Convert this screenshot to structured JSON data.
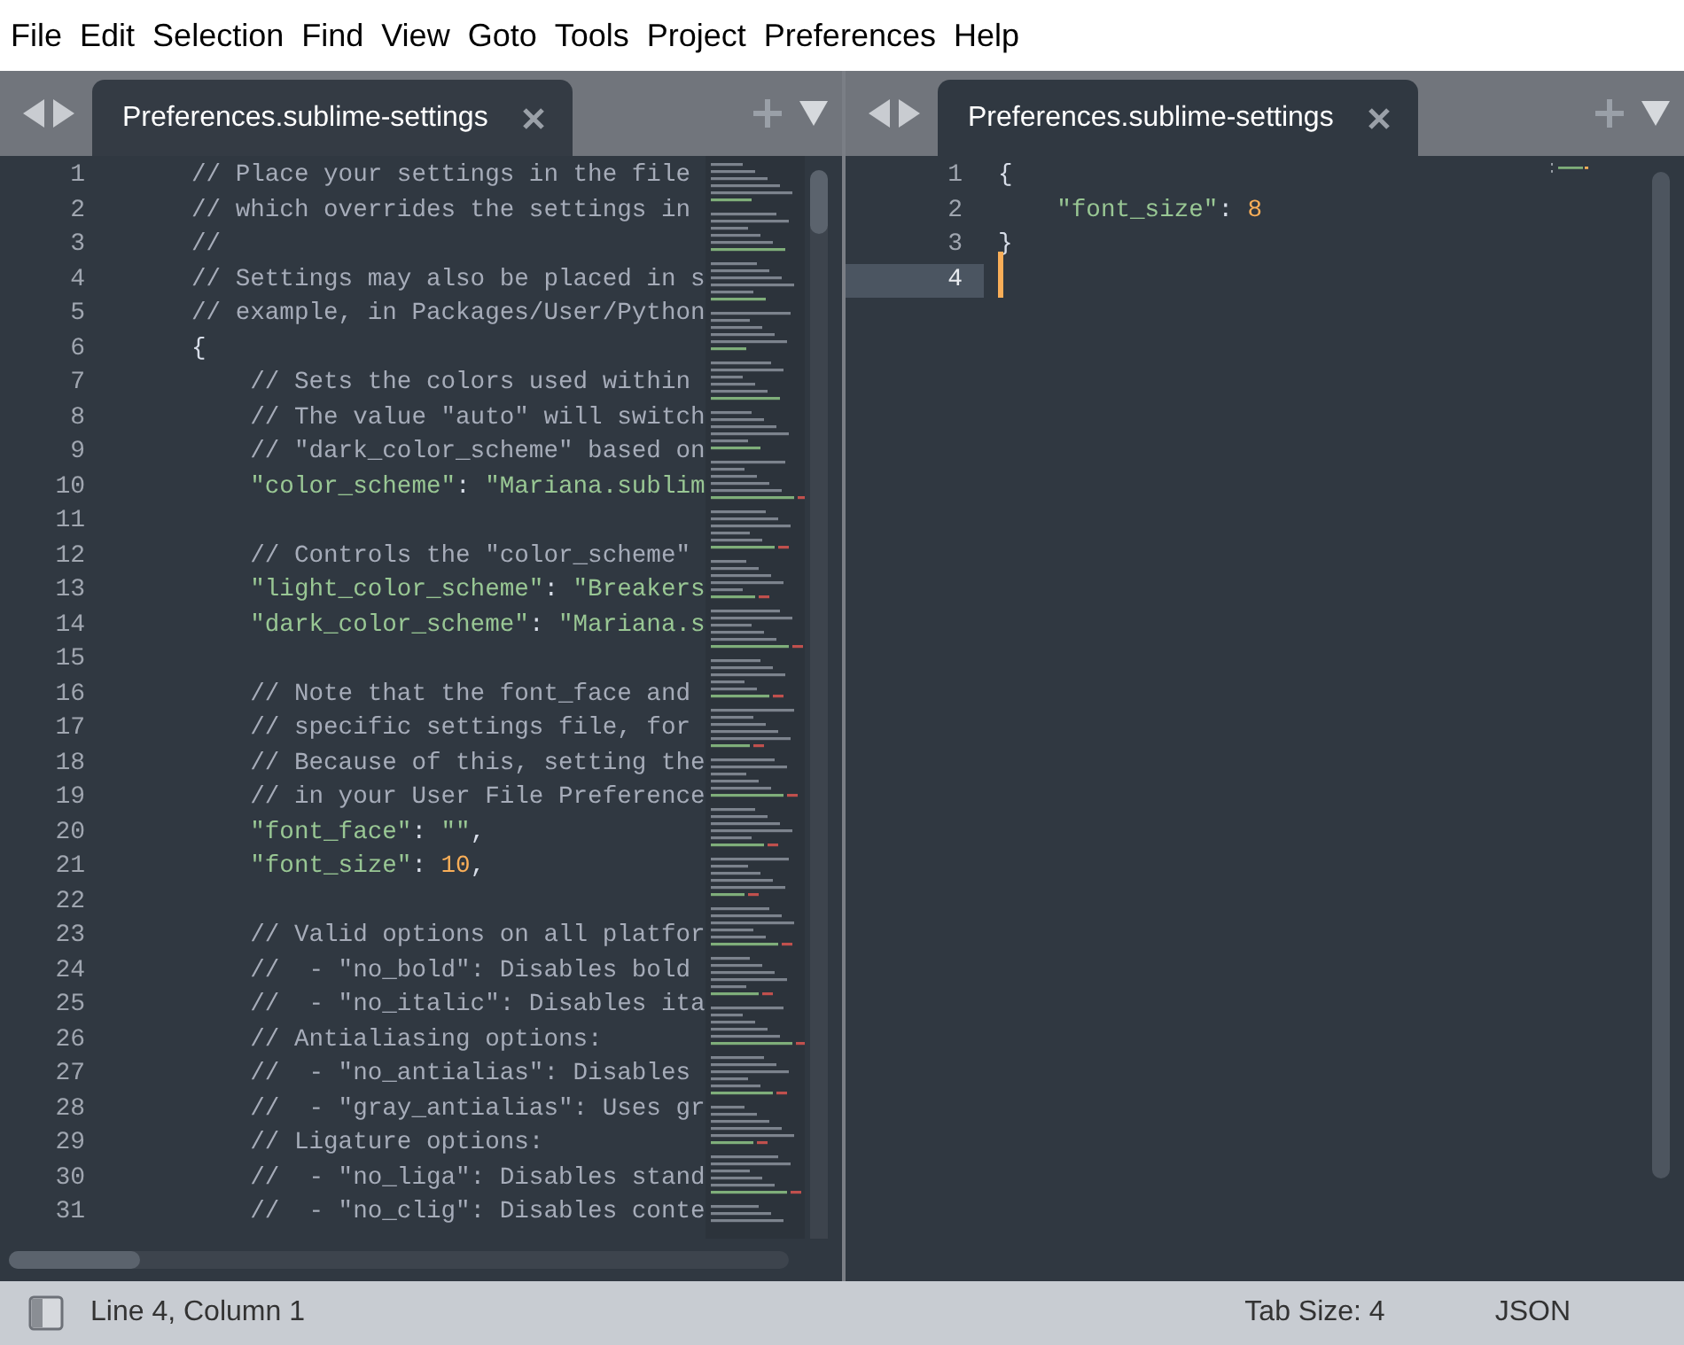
{
  "menu": [
    "File",
    "Edit",
    "Selection",
    "Find",
    "View",
    "Goto",
    "Tools",
    "Project",
    "Preferences",
    "Help"
  ],
  "panes": [
    {
      "tab": {
        "title": "Preferences.sublime-settings",
        "selected": true
      },
      "lines": [
        {
          "n": "1",
          "current": false,
          "tokens": [
            {
              "kind": "comment",
              "text": "// Place your settings in the file"
            }
          ]
        },
        {
          "n": "2",
          "current": false,
          "tokens": [
            {
              "kind": "comment",
              "text": "// which overrides the settings in"
            }
          ]
        },
        {
          "n": "3",
          "current": false,
          "tokens": [
            {
              "kind": "comment",
              "text": "//"
            }
          ]
        },
        {
          "n": "4",
          "current": false,
          "tokens": [
            {
              "kind": "comment",
              "text": "// Settings may also be placed in s"
            }
          ]
        },
        {
          "n": "5",
          "current": false,
          "tokens": [
            {
              "kind": "comment",
              "text": "// example, in Packages/User/Python"
            }
          ]
        },
        {
          "n": "6",
          "current": false,
          "tokens": [
            {
              "kind": "punct",
              "text": "{"
            }
          ]
        },
        {
          "n": "7",
          "current": false,
          "tokens": [
            {
              "kind": "comment",
              "text": "    // Sets the colors used within"
            }
          ]
        },
        {
          "n": "8",
          "current": false,
          "tokens": [
            {
              "kind": "comment",
              "text": "    // The value \"auto\" will switch"
            }
          ]
        },
        {
          "n": "9",
          "current": false,
          "tokens": [
            {
              "kind": "comment",
              "text": "    // \"dark_color_scheme\" based on"
            }
          ]
        },
        {
          "n": "10",
          "current": false,
          "tokens": [
            {
              "kind": "string",
              "text": "    \"color_scheme\""
            },
            {
              "kind": "punct",
              "text": ": "
            },
            {
              "kind": "string",
              "text": "\"Mariana.sublim"
            }
          ]
        },
        {
          "n": "11",
          "current": false
        },
        {
          "n": "12",
          "current": false,
          "tokens": [
            {
              "kind": "comment",
              "text": "    // Controls the \"color_scheme\""
            }
          ]
        },
        {
          "n": "13",
          "current": false,
          "tokens": [
            {
              "kind": "string",
              "text": "    \"light_color_scheme\""
            },
            {
              "kind": "punct",
              "text": ": "
            },
            {
              "kind": "string",
              "text": "\"Breakers"
            }
          ]
        },
        {
          "n": "14",
          "current": false,
          "tokens": [
            {
              "kind": "string",
              "text": "    \"dark_color_scheme\""
            },
            {
              "kind": "punct",
              "text": ": "
            },
            {
              "kind": "string",
              "text": "\"Mariana.s"
            }
          ]
        },
        {
          "n": "15",
          "current": false
        },
        {
          "n": "16",
          "current": false,
          "tokens": [
            {
              "kind": "comment",
              "text": "    // Note that the font_face and"
            }
          ]
        },
        {
          "n": "17",
          "current": false,
          "tokens": [
            {
              "kind": "comment",
              "text": "    // specific settings file, for"
            }
          ]
        },
        {
          "n": "18",
          "current": false,
          "tokens": [
            {
              "kind": "comment",
              "text": "    // Because of this, setting the"
            }
          ]
        },
        {
          "n": "19",
          "current": false,
          "tokens": [
            {
              "kind": "comment",
              "text": "    // in your User File Preference"
            }
          ]
        },
        {
          "n": "20",
          "current": false,
          "tokens": [
            {
              "kind": "string",
              "text": "    \"font_face\""
            },
            {
              "kind": "punct",
              "text": ": "
            },
            {
              "kind": "string",
              "text": "\"\""
            },
            {
              "kind": "punct",
              "text": ","
            }
          ]
        },
        {
          "n": "21",
          "current": false,
          "tokens": [
            {
              "kind": "string",
              "text": "    \"font_size\""
            },
            {
              "kind": "punct",
              "text": ": "
            },
            {
              "kind": "number",
              "text": "10"
            },
            {
              "kind": "punct",
              "text": ","
            }
          ]
        },
        {
          "n": "22",
          "current": false
        },
        {
          "n": "23",
          "current": false,
          "tokens": [
            {
              "kind": "comment",
              "text": "    // Valid options on all platfor"
            }
          ]
        },
        {
          "n": "24",
          "current": false,
          "tokens": [
            {
              "kind": "comment",
              "text": "    //  - \"no_bold\": Disables bold"
            }
          ]
        },
        {
          "n": "25",
          "current": false,
          "tokens": [
            {
              "kind": "comment",
              "text": "    //  - \"no_italic\": Disables ita"
            }
          ]
        },
        {
          "n": "26",
          "current": false,
          "tokens": [
            {
              "kind": "comment",
              "text": "    // Antialiasing options:"
            }
          ]
        },
        {
          "n": "27",
          "current": false,
          "tokens": [
            {
              "kind": "comment",
              "text": "    //  - \"no_antialias\": Disables"
            }
          ]
        },
        {
          "n": "28",
          "current": false,
          "tokens": [
            {
              "kind": "comment",
              "text": "    //  - \"gray_antialias\": Uses gr"
            }
          ]
        },
        {
          "n": "29",
          "current": false,
          "tokens": [
            {
              "kind": "comment",
              "text": "    // Ligature options:"
            }
          ]
        },
        {
          "n": "30",
          "current": false,
          "tokens": [
            {
              "kind": "comment",
              "text": "    //  - \"no_liga\": Disables stand"
            }
          ]
        },
        {
          "n": "31",
          "current": false,
          "tokens": [
            {
              "kind": "comment",
              "text": "    //  - \"no_clig\": Disables conte"
            }
          ]
        }
      ]
    },
    {
      "tab": {
        "title": "Preferences.sublime-settings",
        "selected": true
      },
      "lines": [
        {
          "n": "1",
          "current": false,
          "tokens": [
            {
              "kind": "punct",
              "text": "{"
            }
          ]
        },
        {
          "n": "2",
          "current": false,
          "tokens": [
            {
              "kind": "string",
              "text": "    \"font_size\""
            },
            {
              "kind": "punct",
              "text": ": "
            },
            {
              "kind": "number",
              "text": "8"
            }
          ]
        },
        {
          "n": "3",
          "current": false,
          "tokens": [
            {
              "kind": "punct",
              "text": "}"
            }
          ]
        },
        {
          "n": "4",
          "current": true
        }
      ]
    }
  ],
  "status_bar": {
    "position": "Line 4, Column 1",
    "tab_size": "Tab Size: 4",
    "syntax": "JSON"
  }
}
